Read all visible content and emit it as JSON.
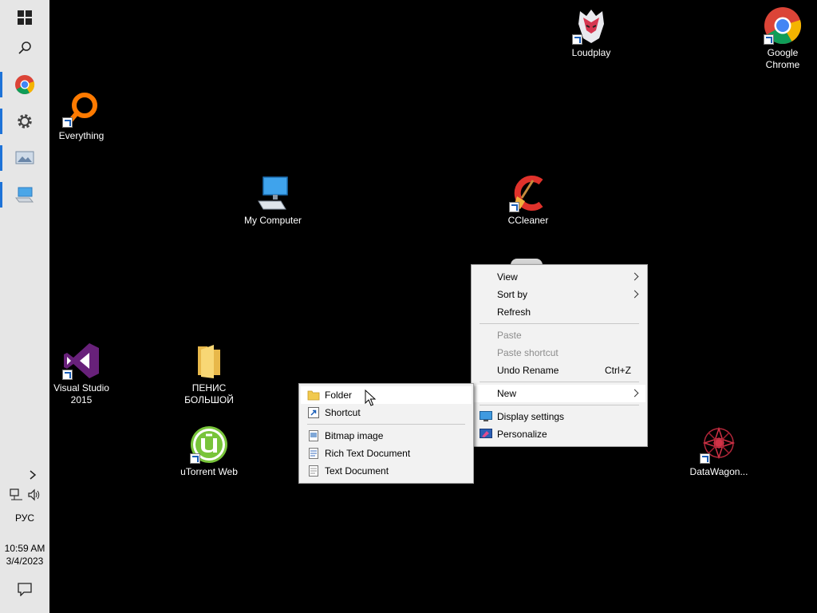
{
  "taskbar": {
    "items": [
      {
        "name": "start-icon"
      },
      {
        "name": "search-icon"
      },
      {
        "name": "chrome-icon"
      },
      {
        "name": "settings-icon"
      },
      {
        "name": "photos-icon"
      },
      {
        "name": "my-computer-icon"
      }
    ],
    "tray": {
      "language": "РУС",
      "time": "10:59 AM",
      "date": "3/4/2023"
    }
  },
  "desktop": {
    "icons": [
      {
        "label": "Loudplay",
        "icon": "loudplay-icon"
      },
      {
        "label": "Google Chrome",
        "icon": "chrome-icon"
      },
      {
        "label": "Everything",
        "icon": "everything-icon"
      },
      {
        "label": "My Computer",
        "icon": "computer-icon"
      },
      {
        "label": "CCleaner",
        "icon": "ccleaner-icon"
      },
      {
        "label": "Visual Studio 2015",
        "icon": "visual-studio-icon"
      },
      {
        "label": "ПЕНИС БОЛЬШОЙ",
        "icon": "folder-icon"
      },
      {
        "label": "uTorrent Web",
        "icon": "utorrent-icon"
      },
      {
        "label": "DataWagon...",
        "icon": "datawagon-icon"
      }
    ]
  },
  "context_menu": {
    "items": [
      {
        "label": "View",
        "submenu": true
      },
      {
        "label": "Sort by",
        "submenu": true
      },
      {
        "label": "Refresh"
      },
      {
        "label": "Paste",
        "disabled": true
      },
      {
        "label": "Paste shortcut",
        "disabled": true
      },
      {
        "label": "Undo Rename",
        "shortcut": "Ctrl+Z"
      },
      {
        "label": "New",
        "submenu": true,
        "highlighted": true
      },
      {
        "label": "Display settings",
        "icon": "display-icon"
      },
      {
        "label": "Personalize",
        "icon": "personalize-icon"
      }
    ]
  },
  "new_submenu": {
    "items": [
      {
        "label": "Folder",
        "icon": "folder-icon",
        "highlighted": true
      },
      {
        "label": "Shortcut",
        "icon": "shortcut-icon"
      },
      {
        "label": "Bitmap image",
        "icon": "bitmap-icon"
      },
      {
        "label": "Rich Text Document",
        "icon": "rtf-icon"
      },
      {
        "label": "Text Document",
        "icon": "text-document-icon"
      }
    ]
  },
  "colors": {
    "taskbar_bg": "#e6e6e6",
    "accent": "#1e73d8",
    "menu_bg": "#f2f2f2",
    "desktop_bg": "#000000"
  }
}
